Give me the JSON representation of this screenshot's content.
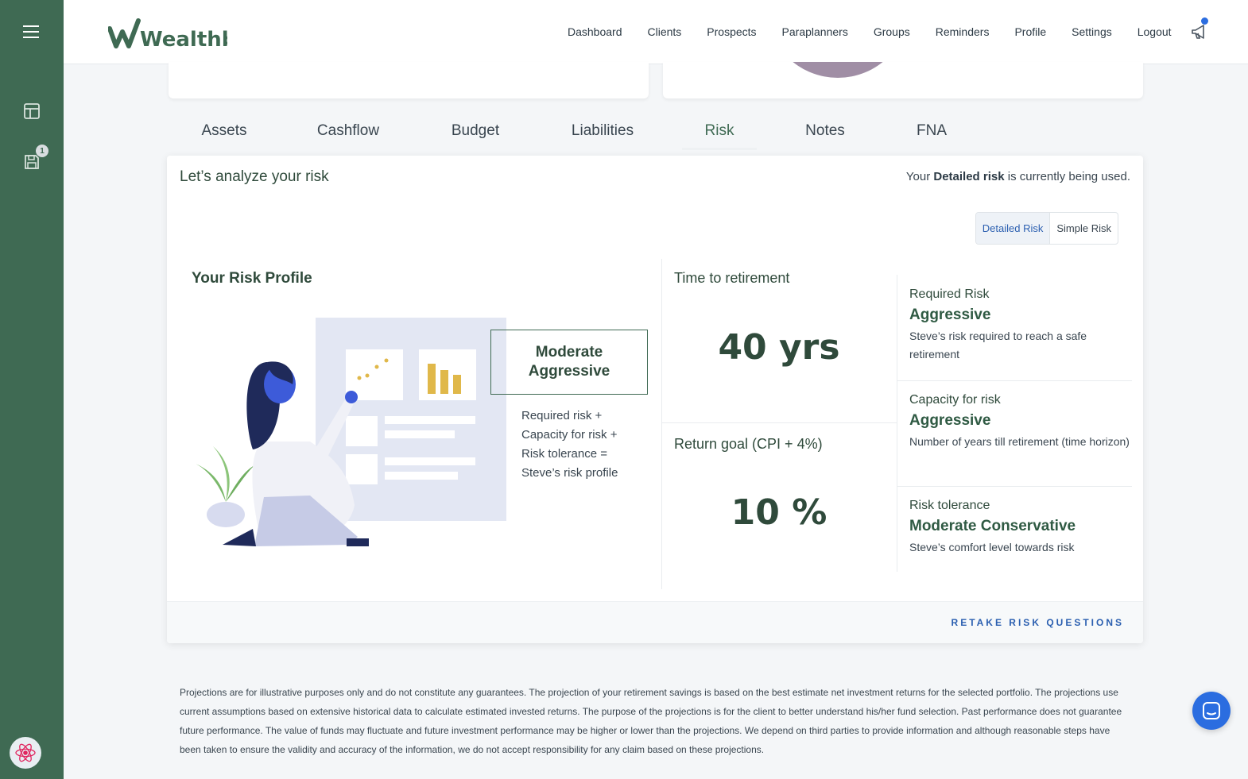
{
  "app": {
    "brand": "Wealthbit"
  },
  "nav": {
    "items": [
      {
        "label": "Dashboard"
      },
      {
        "label": "Clients"
      },
      {
        "label": "Prospects"
      },
      {
        "label": "Paraplanners"
      },
      {
        "label": "Groups"
      },
      {
        "label": "Reminders"
      },
      {
        "label": "Profile"
      },
      {
        "label": "Settings"
      },
      {
        "label": "Logout"
      }
    ]
  },
  "sidebar": {
    "icons": [
      "menu-icon",
      "layout-icon",
      "save-icon"
    ],
    "save_badge": "1"
  },
  "tabs": [
    {
      "label": "Assets"
    },
    {
      "label": "Cashflow"
    },
    {
      "label": "Budget"
    },
    {
      "label": "Liabilities"
    },
    {
      "label": "Risk",
      "active": true
    },
    {
      "label": "Notes"
    },
    {
      "label": "FNA"
    }
  ],
  "risk": {
    "title": "Let’s analyze your risk",
    "status_prefix": "Your ",
    "status_bold": "Detailed risk",
    "status_suffix": " is currently being used.",
    "toggle": {
      "detailed": "Detailed Risk",
      "simple": "Simple Risk",
      "selected": "Detailed Risk"
    },
    "profile": {
      "heading": "Your Risk Profile",
      "value_line1": "Moderate",
      "value_line2": "Aggressive",
      "formula": [
        "Required risk +",
        "Capacity for risk +",
        "Risk tolerance =",
        "Steve’s risk profile"
      ]
    },
    "time_to_retirement": {
      "label": "Time to retirement",
      "value": "40 yrs"
    },
    "return_goal": {
      "label": "Return goal (CPI + 4%)",
      "value": "10 %"
    },
    "items": [
      {
        "label": "Required Risk",
        "value": "Aggressive",
        "desc": "Steve’s risk required to reach a safe retirement"
      },
      {
        "label": "Capacity for risk",
        "value": "Aggressive",
        "desc": "Number of years till retirement (time horizon)"
      },
      {
        "label": "Risk tolerance",
        "value": "Moderate Conservative",
        "desc": "Steve’s comfort level towards risk"
      }
    ],
    "retake_label": "RETAKE RISK QUESTIONS"
  },
  "disclaimer": "Projections are for illustrative purposes only and do not constitute any guarantees. The projection of your retirement savings is based on the best estimate net investment returns for the selected portfolio. The projections use current assumptions based on extensive historical data to calculate estimated invested returns. The purpose of the projections is for the client to better understand his/her fund selection. Past performance does not guarantee future performance. The value of funds may fluctuate and future investment performance may be higher or lower than the projections. We depend on third parties to provide information and although reasonable steps have been taken to ensure the validity and accuracy of the information, we do not accept responsibility for any claim based on these projections.",
  "colors": {
    "brand_green": "#3f6a53",
    "link_blue": "#2b5fb0",
    "chat_blue": "#2b6de0"
  }
}
